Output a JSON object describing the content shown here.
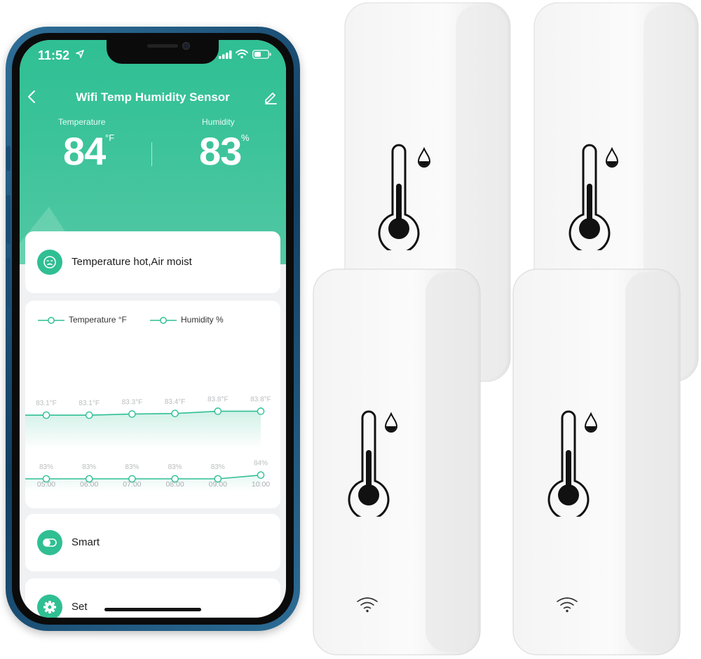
{
  "status_bar": {
    "time": "11:52",
    "icons": [
      "location-icon",
      "signal-icon",
      "wifi-icon",
      "battery-icon"
    ]
  },
  "nav": {
    "title": "Wifi Temp Humidity Sensor",
    "back_icon": "chevron-left-icon",
    "edit_icon": "pencil-icon"
  },
  "readings": {
    "temperature": {
      "label": "Temperature",
      "value": "84",
      "unit": "°F"
    },
    "humidity": {
      "label": "Humidity",
      "value": "83",
      "unit": "%"
    }
  },
  "status_card": {
    "icon": "face-icon",
    "text": "Temperature hot,Air moist"
  },
  "legend": [
    {
      "label": "Temperature °F"
    },
    {
      "label": "Humidity %"
    }
  ],
  "chart_data": {
    "type": "line",
    "x": [
      "05:00",
      "06:00",
      "07:00",
      "08:00",
      "09:00",
      "10:00"
    ],
    "series": [
      {
        "name": "Temperature °F",
        "values": [
          83.1,
          83.1,
          83.3,
          83.4,
          83.8,
          83.8
        ],
        "labels": [
          "83.1°F",
          "83.1°F",
          "83.3°F",
          "83.4°F",
          "83.8°F",
          "83.8°F"
        ]
      },
      {
        "name": "Humidity %",
        "values": [
          83,
          83,
          83,
          83,
          83,
          84
        ],
        "labels": [
          "83%",
          "83%",
          "83%",
          "83%",
          "83%",
          "84%"
        ]
      }
    ],
    "grid": false,
    "legend_position": "top-left"
  },
  "menu": [
    {
      "icon": "toggle-icon",
      "label": "Smart"
    },
    {
      "icon": "gear-icon",
      "label": "Set"
    }
  ],
  "colors": {
    "accent": "#2fbf93",
    "card": "#ffffff",
    "screen_bg": "#f0f1f3",
    "phone_frame": "#1b4d73"
  },
  "device_icons": [
    "thermometer-icon",
    "water-drop-icon",
    "wifi-icon"
  ]
}
